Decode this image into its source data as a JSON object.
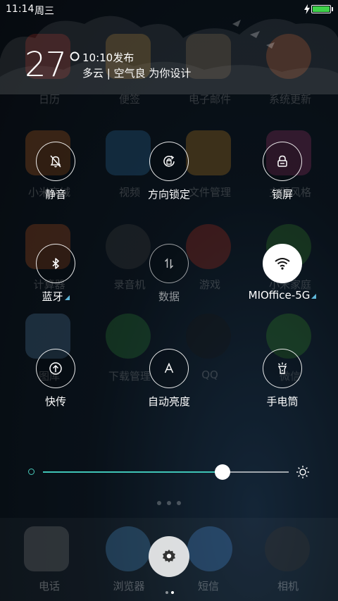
{
  "status_bar": {
    "time": "11:14",
    "weekday": "周三"
  },
  "weather": {
    "temperature": "27°",
    "published": "10:10发布",
    "summary": "多云 | 空气良 为你设计"
  },
  "toggles": {
    "mute": {
      "label": "静音",
      "icon": "bell-slash-icon",
      "on": false
    },
    "rotation_lock": {
      "label": "方向锁定",
      "icon": "rotation-lock-icon",
      "on": false
    },
    "lock_screen": {
      "label": "锁屏",
      "icon": "lock-icon",
      "on": false
    },
    "bluetooth": {
      "label": "蓝牙",
      "icon": "bluetooth-icon",
      "on": false
    },
    "data": {
      "label": "数据",
      "icon": "data-arrows-icon",
      "on": false
    },
    "wifi": {
      "label": "MIOffice-5G",
      "icon": "wifi-icon",
      "on": true
    },
    "transfer": {
      "label": "快传",
      "icon": "upload-icon",
      "on": false
    },
    "auto_brightness": {
      "label": "自动亮度",
      "icon": "letter-a-icon",
      "on": false
    },
    "flashlight": {
      "label": "手电筒",
      "icon": "flashlight-icon",
      "on": false
    }
  },
  "brightness": {
    "level": 0.73
  },
  "background_apps": [
    "日历",
    "便签",
    "电子邮件",
    "系统更新",
    "小米商城",
    "视频",
    "文件管理",
    "主题风格",
    "计算器",
    "录音机",
    "游戏",
    "小米家庭",
    "图库",
    "下载管理",
    "QQ",
    "微信"
  ],
  "dock_apps": [
    "电话",
    "浏览器",
    "短信",
    "相机"
  ],
  "colors": {
    "accent": "#3fc4b6",
    "battery": "#3fd24a",
    "wifi_on_bg": "#ffffff"
  }
}
